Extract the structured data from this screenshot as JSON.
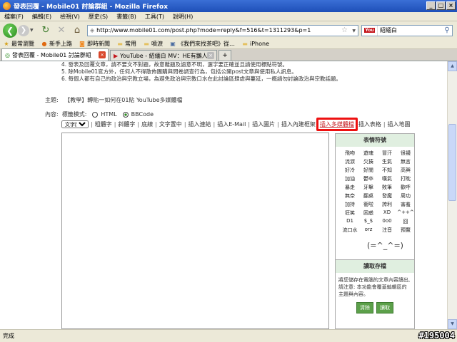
{
  "window": {
    "title": "發表回覆 - Mobile01 討論群組 - Mozilla Firefox"
  },
  "menu": [
    "檔案(F)",
    "編輯(E)",
    "檢視(V)",
    "歷史(S)",
    "書籤(B)",
    "工具(T)",
    "說明(H)"
  ],
  "nav": {
    "url": "http://www.mobile01.com/post.php?mode=reply&f=516&t=1311293&p=1",
    "search_value": "紹緬白"
  },
  "bookmarks": [
    "最常瀏覽",
    "新手上路",
    "即時新聞",
    "常用",
    "噴淚",
    "《我們來找茶吧》從…",
    "iPhone"
  ],
  "tabs": [
    {
      "label": "發表回覆 - Mobile01 討論群組",
      "active": true
    },
    {
      "label": "YouTube - 紹緬白 MV：HE有鵝人",
      "active": false
    }
  ],
  "rules": [
    "4. 發表及回覆文章，請不要文不對題，故意離題及語意不明，選字要正確並且請使用標點符號。",
    "5. 除Mobile01官方外，任何人不得散佈團購與問卷調查行為，包括公開post文章與使用私人訊息。",
    "6. 每個人都有自己的政治與宗教立場，為避免政治與宗教口水在此討論區肆虐與蔓延，一概請勿討論政治與宗教話題。"
  ],
  "form": {
    "subject_label": "主題:",
    "subject_value": "【教學】轉貼一如何在01貼 YouTube多媒體檔",
    "content_label": "內容:",
    "mode_label": "標籤模式:",
    "mode_html": "HTML",
    "mode_bbcode": "BBCode",
    "color_select": "文字顏色",
    "tools": [
      "粗體字",
      "斜體字",
      "底線",
      "文字置中",
      "插入連結",
      "插入E-Mail",
      "插入圖片",
      "插入內建框架"
    ],
    "highlight_tool": "插入多媒體檔",
    "tools_after": [
      "插入表格",
      "插入地圖"
    ]
  },
  "emote_panel": {
    "title": "表情符號",
    "items": [
      "飛吻",
      "遊魂",
      "冒汗",
      "很襪",
      "流淚",
      "欠揍",
      "生氣",
      "無言",
      "好冷",
      "好閒",
      "不知",
      "高興",
      "加油",
      "鬱卒",
      "嘆氣",
      "打眈",
      "暴走",
      "牙擊",
      "敗筆",
      "歡呼",
      "無奈",
      "翻桌",
      "發魔",
      "周功",
      "加持",
      "衝啦",
      "誇利",
      "害羞",
      "狂笑",
      "困惑",
      "XD",
      "^++^",
      "D1",
      "$_$",
      "0o0",
      "囧",
      "流口水",
      "orz",
      "注音",
      "預覽"
    ],
    "mascot": "(=^_^=)"
  },
  "draft_panel": {
    "title": "讀取存檔",
    "desc": "將您儲存在電腦的文章內容讀出, 請注意: 本功能會覆蓋編輯區的主題與內容。",
    "clear_label": "清除",
    "load_label": "讀取"
  },
  "status": "完成",
  "watermark": "#195004"
}
